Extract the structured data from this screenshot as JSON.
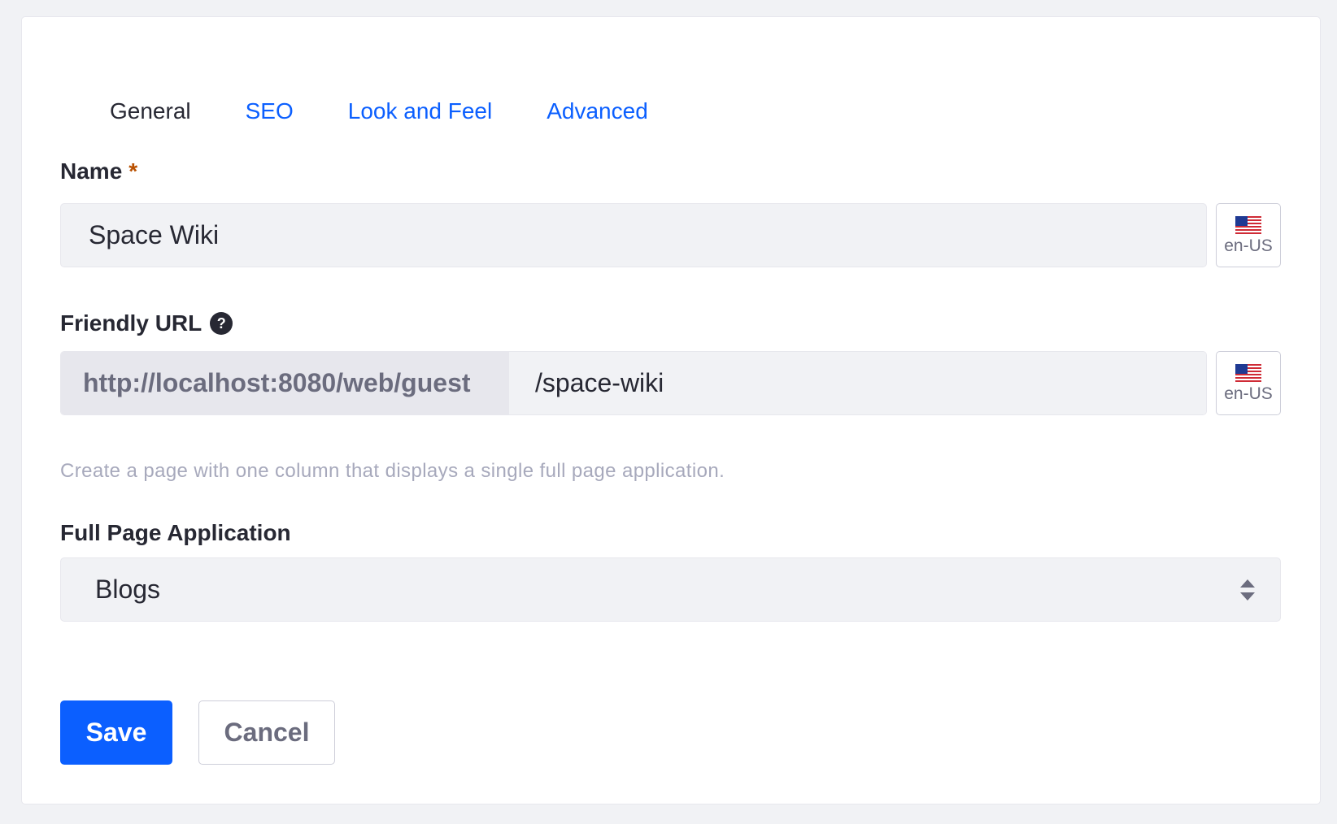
{
  "tabs": [
    {
      "label": "General",
      "active": true
    },
    {
      "label": "SEO",
      "active": false
    },
    {
      "label": "Look and Feel",
      "active": false
    },
    {
      "label": "Advanced",
      "active": false
    }
  ],
  "name_field": {
    "label": "Name",
    "required_marker": "*",
    "value": "Space Wiki",
    "locale": "en-US"
  },
  "friendly_url": {
    "label": "Friendly URL",
    "help_icon_glyph": "?",
    "prefix": "http://localhost:8080/web/guest",
    "value": "/space-wiki",
    "locale": "en-US"
  },
  "description": "Create a page with one column that displays a single full page application.",
  "full_page_application": {
    "label": "Full Page Application",
    "selected": "Blogs"
  },
  "actions": {
    "save_label": "Save",
    "cancel_label": "Cancel"
  },
  "colors": {
    "primary": "#0b5fff",
    "required": "#b95000",
    "text": "#272833",
    "muted": "#6b6c7e",
    "input_bg": "#f1f2f5"
  },
  "icons": {
    "locale_flag": "us-flag-icon",
    "help": "question-circle-icon",
    "select_arrows": "caret-double-icon"
  }
}
